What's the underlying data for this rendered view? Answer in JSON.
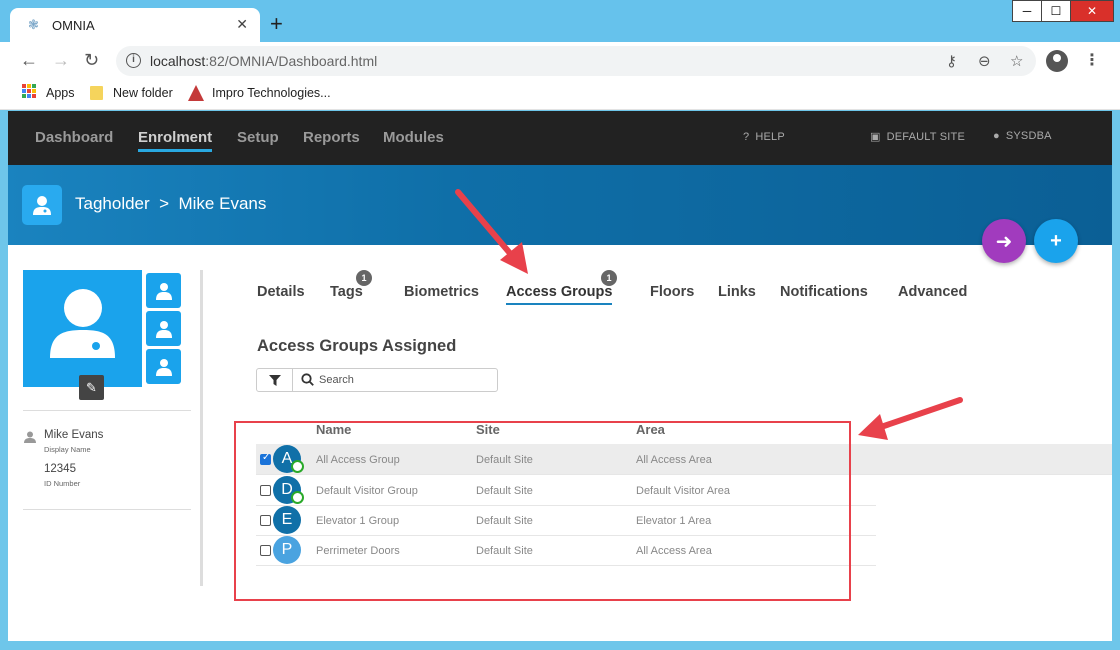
{
  "browser": {
    "tab_title": "OMNIA",
    "url_host": "localhost",
    "url_rest": ":82/OMNIA/Dashboard.html",
    "bookmarks": [
      {
        "label": "Apps"
      },
      {
        "label": "New folder"
      },
      {
        "label": "Impro Technologies..."
      }
    ]
  },
  "nav": {
    "items": [
      "Dashboard",
      "Enrolment",
      "Setup",
      "Reports",
      "Modules"
    ],
    "active": "Enrolment",
    "help": "HELP",
    "site": "DEFAULT SITE",
    "user": "SYSDBA"
  },
  "banner": {
    "title": "Tagholder  >  Mike Evans"
  },
  "profile": {
    "name": "Mike Evans",
    "name_caption": "Display Name",
    "id": "12345",
    "id_caption": "ID Number"
  },
  "tabs": [
    {
      "label": "Details"
    },
    {
      "label": "Tags",
      "badge": "1"
    },
    {
      "label": "Biometrics"
    },
    {
      "label": "Access Groups",
      "badge": "1",
      "active": true
    },
    {
      "label": "Floors"
    },
    {
      "label": "Links"
    },
    {
      "label": "Notifications"
    },
    {
      "label": "Advanced"
    }
  ],
  "section": {
    "title": "Access Groups Assigned",
    "search_placeholder": "Search"
  },
  "table": {
    "columns": [
      "Name",
      "Site",
      "Area"
    ],
    "rows": [
      {
        "letter": "A",
        "name": "All Access Group",
        "site": "Default Site",
        "area": "All Access Area",
        "checked": true,
        "synced": true,
        "color": "#1070a8"
      },
      {
        "letter": "D",
        "name": "Default Visitor Group",
        "site": "Default Site",
        "area": "Default Visitor Area",
        "checked": false,
        "synced": true,
        "color": "#1070a8"
      },
      {
        "letter": "E",
        "name": "Elevator 1 Group",
        "site": "Default Site",
        "area": "Elevator 1 Area",
        "checked": false,
        "synced": false,
        "color": "#1070a8"
      },
      {
        "letter": "P",
        "name": "Perrimeter Doors",
        "site": "Default Site",
        "area": "All Access Area",
        "checked": false,
        "synced": false,
        "color": "#4aa3e0"
      }
    ]
  },
  "colors": {
    "nav_bg": "#222222",
    "banner": "#0f6fa8",
    "accent": "#1aa3ec",
    "back_fab": "#a13bbe",
    "highlight": "#e8414b"
  }
}
